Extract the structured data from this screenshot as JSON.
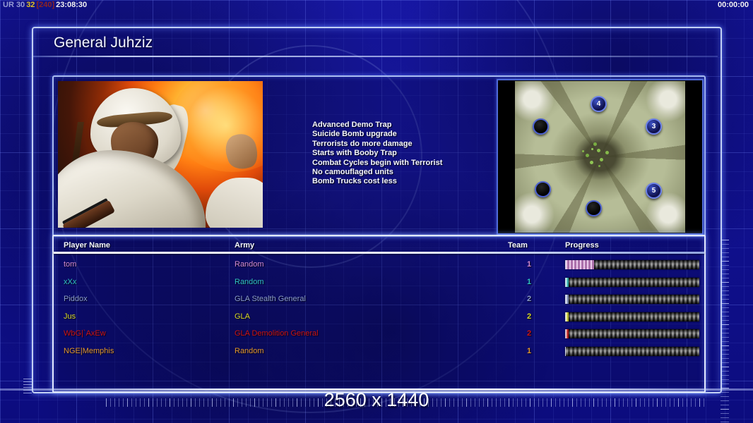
{
  "hud": {
    "session": "UR 30",
    "fps": "32",
    "cap": "[240]",
    "clock": "23:08:30",
    "match_timer": "00:00:00",
    "colors": {
      "session": "#969cd4",
      "fps": "#e3c31d",
      "cap": "#8c2424",
      "clock": "#f2f2f2"
    }
  },
  "header": {
    "title": "General Juhziz"
  },
  "bonuses": [
    "Advanced Demo Trap",
    "Suicide Bomb upgrade",
    "Terrorists do more damage",
    "Starts with Booby Trap",
    "Combat Cycles begin with Terrorist",
    "No camouflaged units",
    "Bomb Trucks cost less"
  ],
  "map_preview": {
    "markers": [
      {
        "label": "4"
      },
      {
        "label": "3"
      },
      {
        "label": "5"
      },
      {
        "label": ""
      },
      {
        "label": ""
      },
      {
        "label": ""
      }
    ]
  },
  "players_table": {
    "headers": {
      "name": "Player Name",
      "army": "Army",
      "team": "Team",
      "progress": "Progress"
    },
    "rows": [
      {
        "name": "tom",
        "army": "Random",
        "team": "1",
        "color": "#d18ad1",
        "progress_pct": 21
      },
      {
        "name": "xXx",
        "army": "Random",
        "team": "1",
        "color": "#30c2c2",
        "progress_pct": 2
      },
      {
        "name": "Piddox",
        "army": "GLA Stealth General",
        "team": "2",
        "color": "#8a9ccc",
        "progress_pct": 2
      },
      {
        "name": "Jus",
        "army": "GLA",
        "team": "2",
        "color": "#d6d62a",
        "progress_pct": 2
      },
      {
        "name": "WbG|`AxEw",
        "army": "GLA Demolition General",
        "team": "2",
        "color": "#cc1414",
        "progress_pct": 2
      },
      {
        "name": "NGE|Memphis",
        "army": "Random",
        "team": "1",
        "color": "#e0962e",
        "progress_pct": 0
      }
    ]
  },
  "watermark": {
    "resolution": "2560 x 1440"
  },
  "colors": {
    "accent_border": "#c3d0f4",
    "background": "#14149e"
  }
}
